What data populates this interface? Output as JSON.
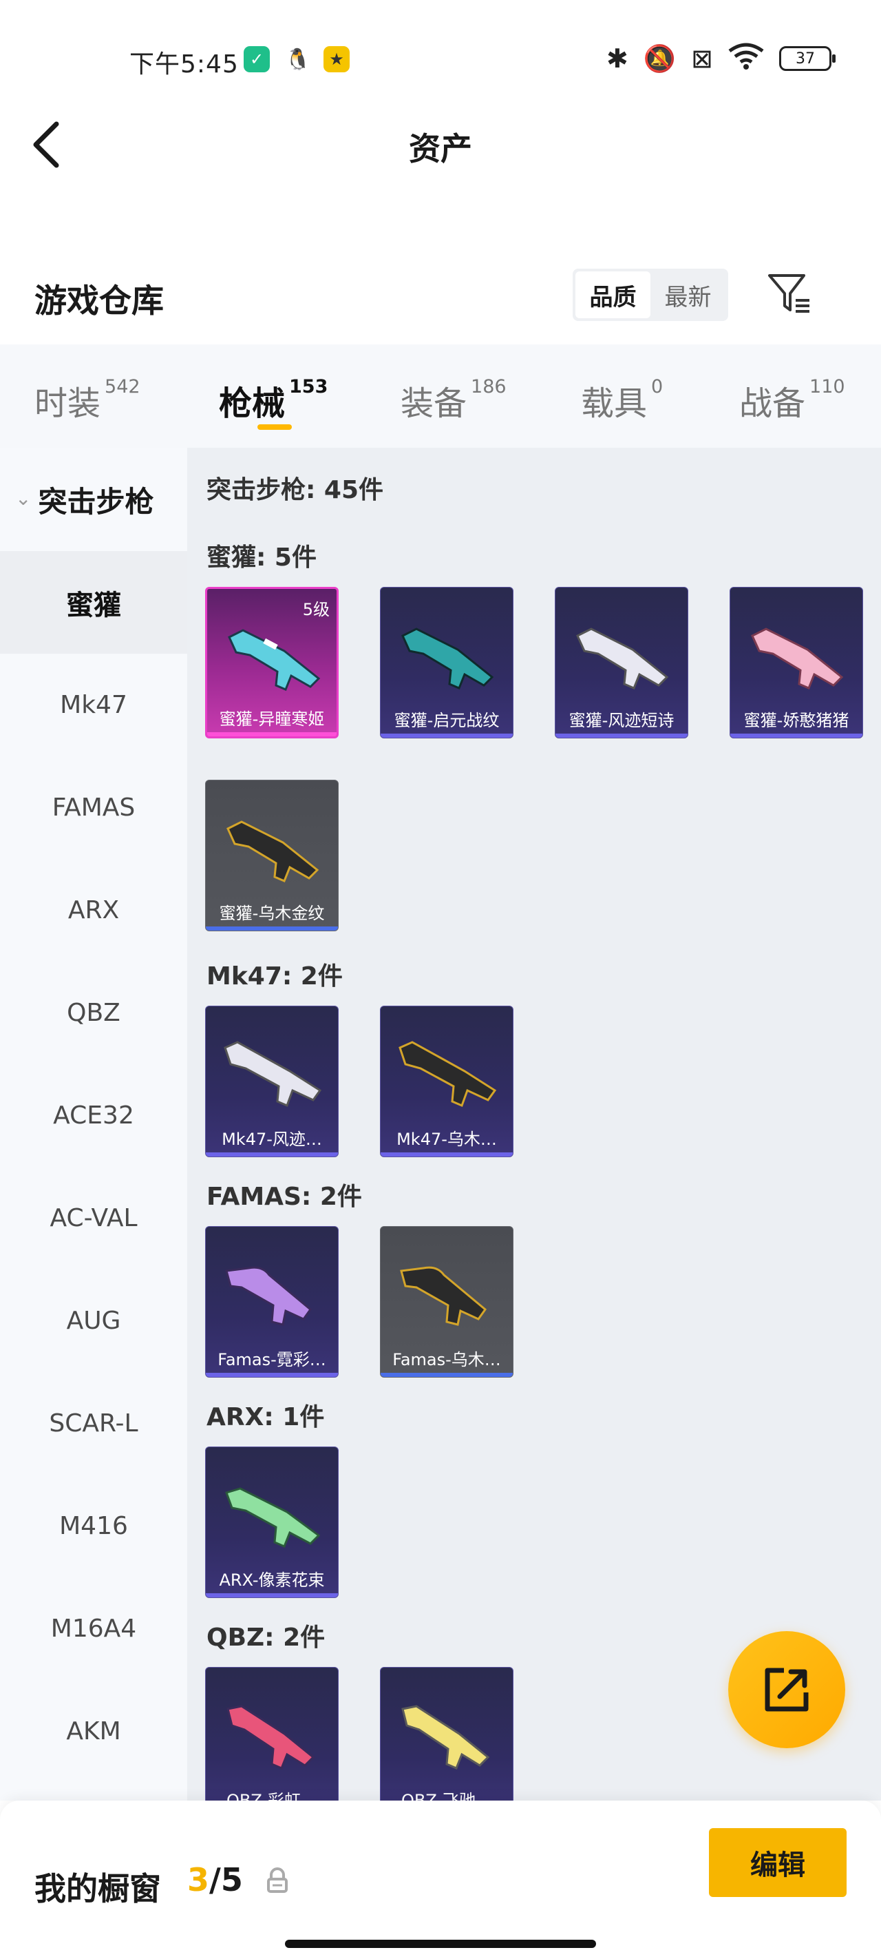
{
  "status_bar": {
    "time": "下午5:45",
    "battery": "37",
    "icons": [
      "app-shield-icon",
      "qq-icon",
      "app-yellow-icon",
      "bluetooth-icon",
      "mute-vibrate-icon",
      "no-sim-icon",
      "wifi-icon",
      "battery-icon"
    ]
  },
  "header": {
    "title": "资产",
    "back_icon": "chevron-left-icon"
  },
  "warehouse": {
    "title": "游戏仓库",
    "sort_options": [
      "品质",
      "最新"
    ],
    "active_sort": "品质",
    "filter_icon": "filter-icon"
  },
  "tabs": [
    {
      "label": "时装",
      "count": "542"
    },
    {
      "label": "枪械",
      "count": "153"
    },
    {
      "label": "装备",
      "count": "186"
    },
    {
      "label": "载具",
      "count": "0"
    },
    {
      "label": "战备",
      "count": "110"
    }
  ],
  "active_tab": "枪械",
  "sidebar": {
    "category": "突击步枪",
    "items": [
      "蜜獾",
      "Mk47",
      "FAMAS",
      "ARX",
      "QBZ",
      "ACE32",
      "AC-VAL",
      "AUG",
      "SCAR-L",
      "M416",
      "M16A4",
      "AKM"
    ],
    "active_item": "蜜獾"
  },
  "content": {
    "category_header": "突击步枪: 45件",
    "groups": [
      {
        "title": "蜜獾: 5件",
        "items": [
          {
            "name": "蜜獾-异瞳寒姬",
            "level": "5级",
            "color": "#ea3fc8"
          },
          {
            "name": "蜜獾-启元战纹",
            "color": "#6c63e8"
          },
          {
            "name": "蜜獾-风迹短诗",
            "color": "#6c63e8"
          },
          {
            "name": "蜜獾-娇憨猪猪",
            "color": "#6c63e8"
          },
          {
            "name": "蜜獾-乌木金纹",
            "color": "#4a6ee8"
          }
        ]
      },
      {
        "title": "Mk47: 2件",
        "items": [
          {
            "name": "Mk47-风迹…",
            "color": "#6c63e8"
          },
          {
            "name": "Mk47-乌木…",
            "color": "#6c63e8"
          }
        ]
      },
      {
        "title": "FAMAS: 2件",
        "items": [
          {
            "name": "Famas-霓彩…",
            "color": "#6c63e8"
          },
          {
            "name": "Famas-乌木…",
            "color": "#4a6ee8"
          }
        ]
      },
      {
        "title": "ARX: 1件",
        "items": [
          {
            "name": "ARX-像素花束",
            "color": "#6c63e8"
          }
        ]
      },
      {
        "title": "QBZ: 2件",
        "items": [
          {
            "name": "QBZ-彩虹…",
            "color": "#6c63e8"
          },
          {
            "name": "QBZ-飞驰…",
            "color": "#6c63e8"
          }
        ]
      }
    ]
  },
  "fab": {
    "icon": "share-external-icon"
  },
  "showcase": {
    "label": "我的橱窗",
    "current": "3",
    "total": "/5",
    "lock_icon": "lock-icon",
    "edit_label": "编辑"
  },
  "colors": {
    "accent": "#ffb800",
    "content_bg": "#eceff3",
    "sidebar_bg": "#f7f9fc",
    "legendary_border": "#ea3fc8",
    "epic_bar": "#6c63e8"
  }
}
